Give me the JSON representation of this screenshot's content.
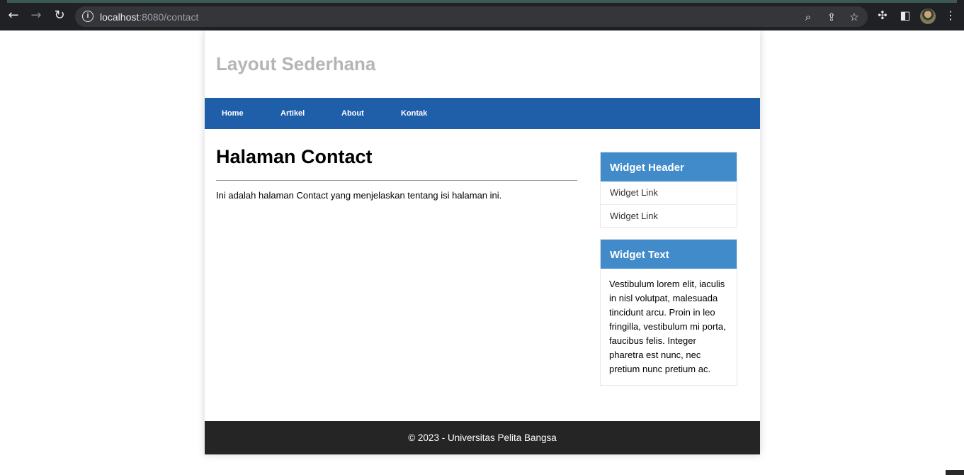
{
  "browser": {
    "url_host": "localhost",
    "url_rest": ":8080/contact",
    "icons": {
      "back": "arrow-left-icon",
      "forward": "arrow-right-icon",
      "reload": "reload-icon",
      "info": "info-icon",
      "zoom": "zoom-icon",
      "share": "share-icon",
      "bookmark": "star-icon",
      "extensions": "puzzle-icon",
      "side_panel": "side-panel-icon",
      "menu": "kebab-menu-icon"
    }
  },
  "site": {
    "title": "Layout Sederhana",
    "nav": [
      "Home",
      "Artikel",
      "About",
      "Kontak"
    ],
    "accent": "#1f5faa",
    "widget_color": "#428bca"
  },
  "main": {
    "heading": "Halaman Contact",
    "text": "Ini adalah halaman Contact yang menjelaskan tentang isi halaman ini."
  },
  "sidebar": {
    "widget_links": {
      "header": "Widget Header",
      "links": [
        "Widget Link",
        "Widget Link"
      ]
    },
    "widget_text": {
      "header": "Widget Text",
      "body": "Vestibulum lorem elit, iaculis in nisl volutpat, malesuada tincidunt arcu. Proin in leo fringilla, vestibulum mi porta, faucibus felis. Integer pharetra est nunc, nec pretium nunc pretium ac."
    }
  },
  "footer": {
    "text": "© 2023 - Universitas Pelita Bangsa"
  }
}
